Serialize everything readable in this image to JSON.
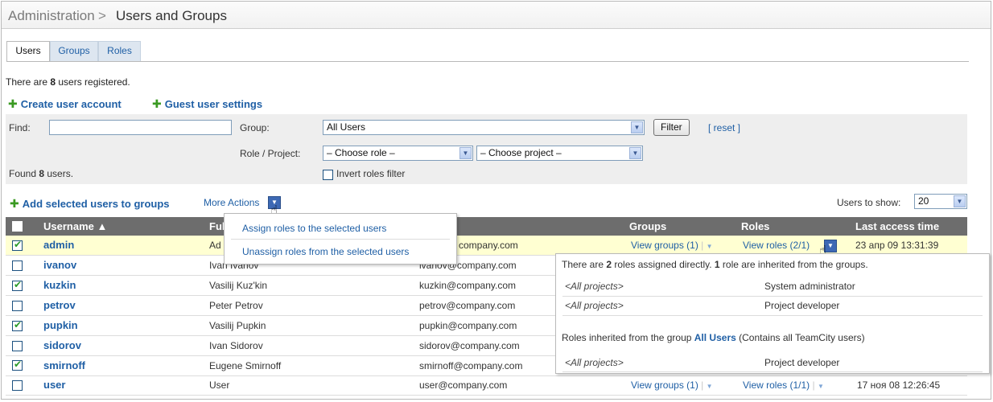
{
  "header": {
    "section": "Administration",
    "separator": ">",
    "title": "Users and Groups"
  },
  "tabs": [
    {
      "label": "Users"
    },
    {
      "label": "Groups"
    },
    {
      "label": "Roles"
    }
  ],
  "summary": {
    "prefix": "There are ",
    "count": "8",
    "suffix": " users registered."
  },
  "actions": {
    "create_user": "Create user account",
    "guest_settings": "Guest user settings"
  },
  "filter": {
    "find_label": "Find:",
    "find_value": "",
    "group_label": "Group:",
    "group_value": "All Users",
    "filter_button": "Filter",
    "reset_link": "[ reset ]",
    "role_project_label": "Role / Project:",
    "role_value": "– Choose role –",
    "project_value": "– Choose project –",
    "found_prefix": "Found ",
    "found_count": "8",
    "found_suffix": " users.",
    "invert_label": "Invert roles filter"
  },
  "toolbar": {
    "add_selected": "Add selected users to groups",
    "more_actions": "More Actions",
    "users_to_show_label": "Users to show:",
    "users_to_show_value": "20"
  },
  "more_actions_menu": [
    "Assign roles to the selected users",
    "Unassign roles from the selected users"
  ],
  "table": {
    "columns": {
      "username": "Username ▲",
      "fullname": "Full",
      "email": "",
      "groups": "Groups",
      "roles": "Roles",
      "last_access": "Last access time"
    },
    "rows": [
      {
        "checked": true,
        "username": "admin",
        "fullname": "Ad",
        "email": "company.com",
        "groups": "View groups (1)",
        "roles": "View roles (2/1)",
        "last_access": "23 апр 09 13:31:39"
      },
      {
        "checked": false,
        "username": "ivanov",
        "fullname": "Ivan Ivanov",
        "email": "ivanov@company.com",
        "groups": "",
        "roles": "",
        "last_access": ""
      },
      {
        "checked": true,
        "username": "kuzkin",
        "fullname": "Vasilij Kuz'kin",
        "email": "kuzkin@company.com",
        "groups": "",
        "roles": "",
        "last_access": ""
      },
      {
        "checked": false,
        "username": "petrov",
        "fullname": "Peter Petrov",
        "email": "petrov@company.com",
        "groups": "",
        "roles": "",
        "last_access": ""
      },
      {
        "checked": true,
        "username": "pupkin",
        "fullname": "Vasilij Pupkin",
        "email": "pupkin@company.com",
        "groups": "",
        "roles": "",
        "last_access": ""
      },
      {
        "checked": false,
        "username": "sidorov",
        "fullname": "Ivan Sidorov",
        "email": "sidorov@company.com",
        "groups": "",
        "roles": "",
        "last_access": ""
      },
      {
        "checked": true,
        "username": "smirnoff",
        "fullname": "Eugene Smirnoff",
        "email": "smirnoff@company.com",
        "groups": "",
        "roles": "",
        "last_access": ""
      },
      {
        "checked": false,
        "username": "user",
        "fullname": "User",
        "email": "user@company.com",
        "groups": "View groups (1)",
        "roles": "View roles (1/1)",
        "last_access": "17 ноя 08 12:26:45"
      }
    ]
  },
  "roles_popup": {
    "intro_a": "There are ",
    "intro_direct": "2",
    "intro_b": " roles assigned directly. ",
    "intro_inherited": "1",
    "intro_c": " role are inherited from the groups.",
    "direct_roles": [
      {
        "project": "<All projects>",
        "role": "System administrator"
      },
      {
        "project": "<All projects>",
        "role": "Project developer"
      }
    ],
    "inherited_a": "Roles inherited from the group ",
    "inherited_group": "All Users",
    "inherited_b": " (Contains all TeamCity users)",
    "inherited_roles": [
      {
        "project": "<All projects>",
        "role": "Project developer"
      }
    ]
  },
  "colors": {
    "link": "#1f5fa5",
    "header_bg": "#6d6d6d",
    "selected_row": "#ffffd2",
    "plus_icon": "#3a9a22"
  }
}
